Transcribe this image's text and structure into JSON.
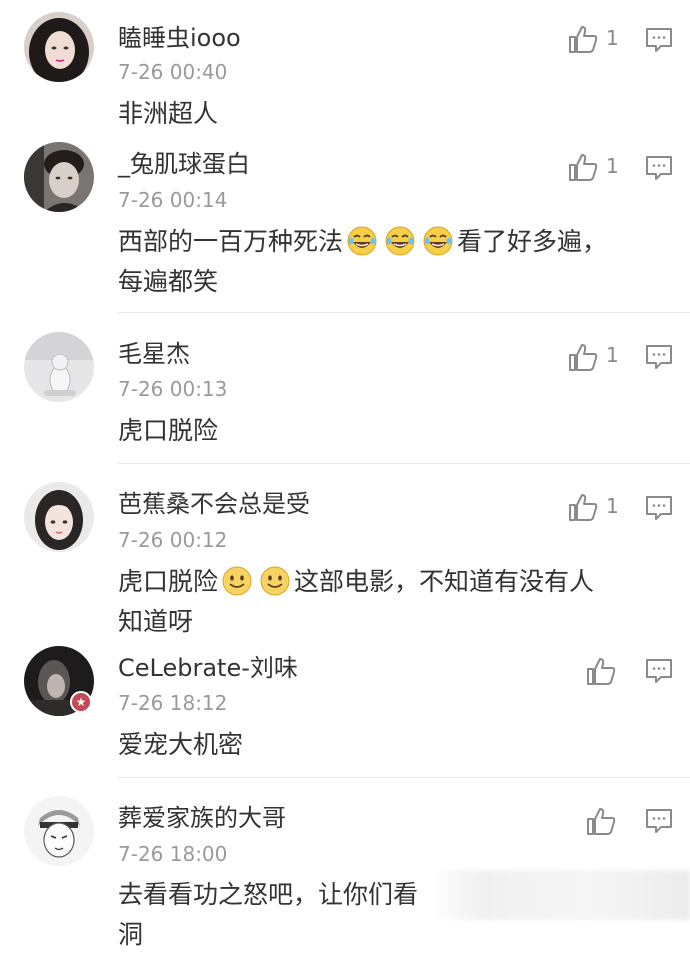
{
  "comments": [
    {
      "user": "瞌睡虫iooo",
      "time": "7-26 00:40",
      "likes": "1",
      "text_parts": [
        "非洲超人"
      ],
      "emojis": [],
      "has_vip_badge": false
    },
    {
      "user": "_兔肌球蛋白",
      "time": "7-26 00:14",
      "likes": "1",
      "text_parts": [
        "西部的一百万种死法",
        "看了好多遍，",
        "每遍都笑"
      ],
      "emojis": [
        "laughing-tears",
        "laughing-tears",
        "laughing-tears"
      ],
      "has_vip_badge": false
    },
    {
      "user": "毛星杰",
      "time": "7-26 00:13",
      "likes": "1",
      "text_parts": [
        "虎口脱险"
      ],
      "emojis": [],
      "has_vip_badge": false
    },
    {
      "user": "芭蕉桑不会总是受",
      "time": "7-26 00:12",
      "likes": "1",
      "text_parts": [
        "虎口脱险",
        "这部电影，不知道有没有人",
        "知道呀"
      ],
      "emojis": [
        "smile",
        "smile"
      ],
      "has_vip_badge": false
    },
    {
      "user": "CeLebrate-刘味",
      "time": "7-26 18:12",
      "likes": "",
      "text_parts": [
        "爱宠大机密"
      ],
      "emojis": [],
      "has_vip_badge": true
    },
    {
      "user": "葬爱家族的大哥",
      "time": "7-26 18:00",
      "likes": "",
      "text_parts": [
        "去看看功之怒吧，让你们看",
        "洞"
      ],
      "emojis": [],
      "has_vip_badge": false
    }
  ],
  "icons": {
    "like": "thumbs-up-icon",
    "reply": "comment-icon",
    "vip": "star-badge-icon"
  },
  "colors": {
    "text": "#333333",
    "meta": "#9a9a9a",
    "icon": "#8a8a8a",
    "divider": "#e6e6e6",
    "badge": "#c34a55"
  }
}
